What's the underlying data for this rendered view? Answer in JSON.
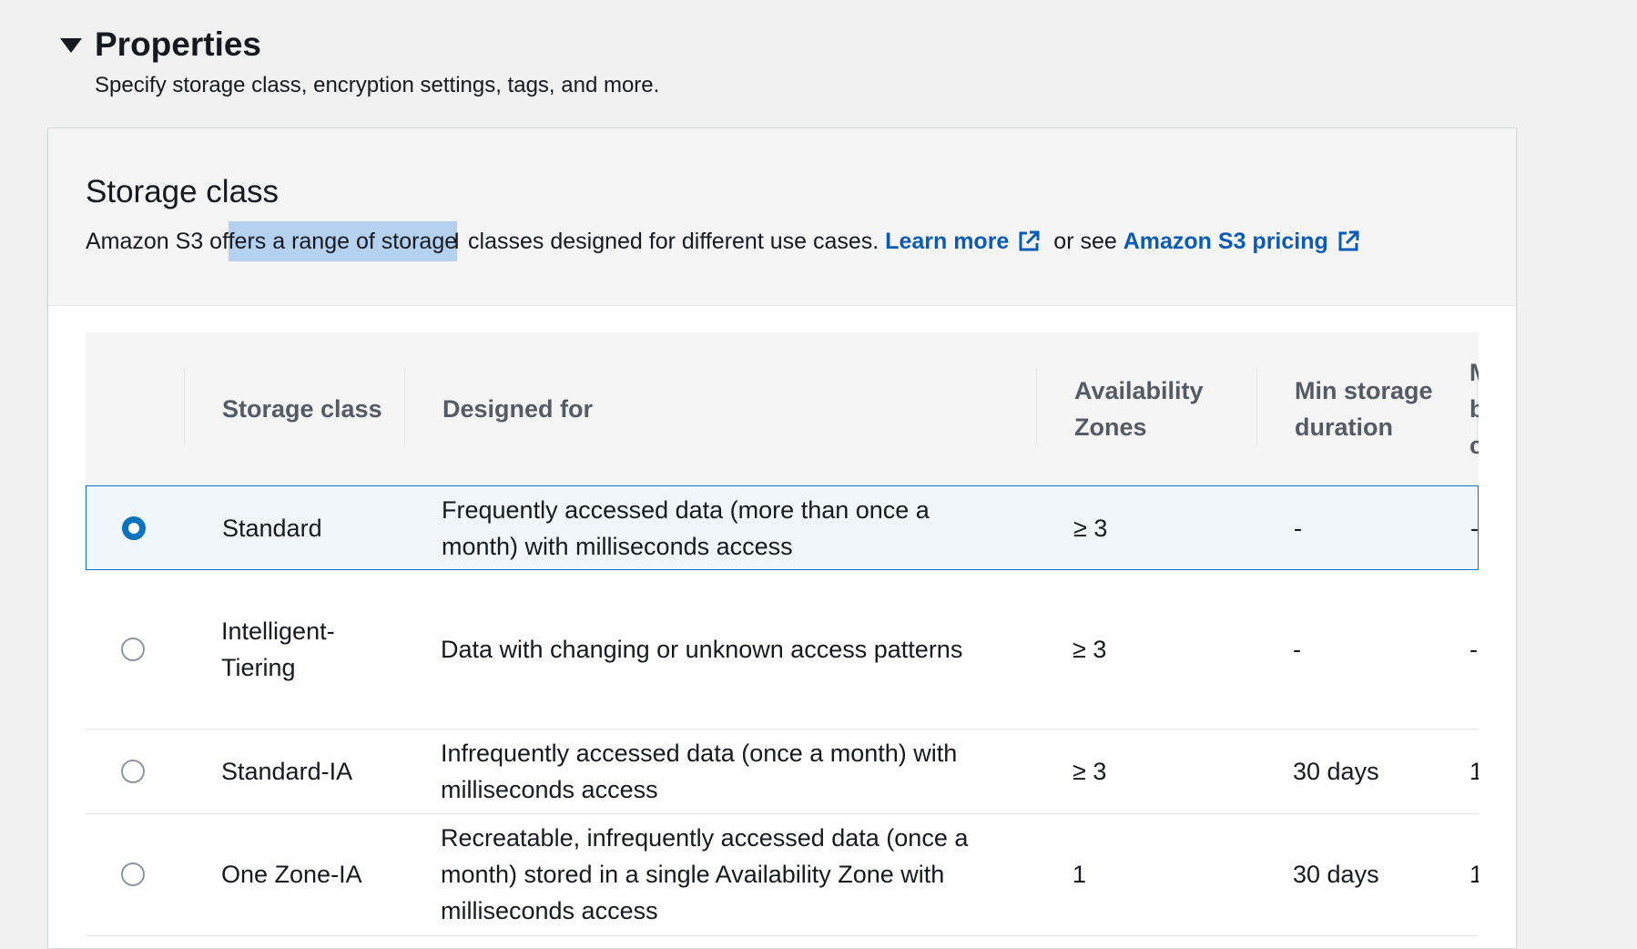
{
  "properties": {
    "title": "Properties",
    "description": "Specify storage class, encryption settings, tags, and more."
  },
  "storage_class": {
    "title": "Storage class",
    "desc_part1": "Amazon S3 of",
    "desc_highlight": "fers a range of storage",
    "desc_part2": " classes designed for different use cases. ",
    "learn_more": "Learn more",
    "or_see": " or see ",
    "pricing_link": "Amazon S3 pricing"
  },
  "table": {
    "headers": {
      "storage_class": "Storage class",
      "designed_for": "Designed for",
      "availability_zones": "Availability Zones",
      "min_storage_duration": "Min storage duration",
      "truncated": "M b c"
    },
    "rows": [
      {
        "name": "Standard",
        "designed_for": "Frequently accessed data (more than once a month) with milliseconds access",
        "az": "≥ 3",
        "min_duration": "-",
        "trunc": "-",
        "selected": true
      },
      {
        "name": "Intelligent-Tiering",
        "designed_for": "Data with changing or unknown access patterns",
        "az": "≥ 3",
        "min_duration": "-",
        "trunc": "-",
        "selected": false
      },
      {
        "name": "Standard-IA",
        "designed_for": "Infrequently accessed data (once a month) with milliseconds access",
        "az": "≥ 3",
        "min_duration": "30 days",
        "trunc": "1",
        "selected": false
      },
      {
        "name": "One Zone-IA",
        "designed_for": "Recreatable, infrequently accessed data (once a month) stored in a single Availability Zone with milliseconds access",
        "az": "1",
        "min_duration": "30 days",
        "trunc": "1",
        "selected": false
      }
    ]
  },
  "colors": {
    "accent": "#0a73bb",
    "link": "#0a5bb7",
    "selected_row_bg": "#f0f7fc",
    "text_highlight": "#b4d2f0"
  },
  "icons": [
    "caret-down-icon",
    "external-link-icon",
    "radio-checked-icon",
    "radio-unchecked-icon"
  ]
}
